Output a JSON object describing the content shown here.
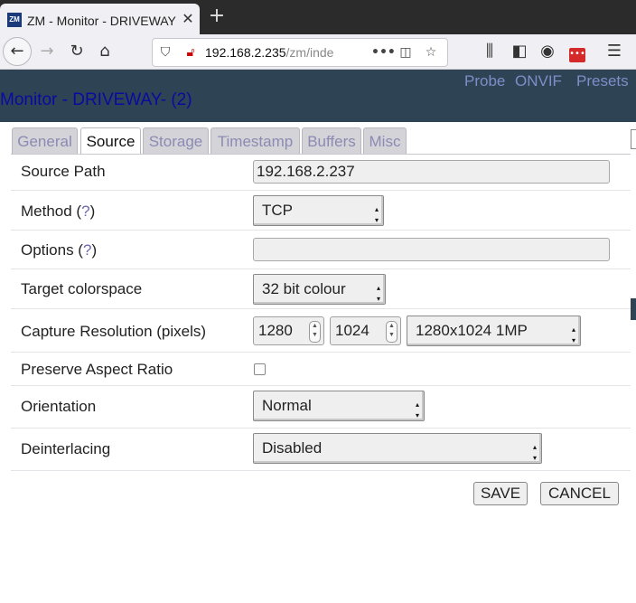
{
  "browser": {
    "tab_favicon": "ZM",
    "tab_title": "ZM - Monitor - DRIVEWAY",
    "tab_close_icon": "close-icon",
    "new_tab_icon": "plus-icon",
    "url_host": "192.168.2.235",
    "url_path": "/zm/inde",
    "page_actions": "•••"
  },
  "header": {
    "title": "Monitor - DRIVEWAY- (2)",
    "links": [
      "Probe",
      "ONVIF",
      "Presets"
    ]
  },
  "tabs": [
    "General",
    "Source",
    "Storage",
    "Timestamp",
    "Buffers",
    "Misc"
  ],
  "active_tab": "Source",
  "form": {
    "source_path": {
      "label": "Source Path",
      "value": "192.168.2.237"
    },
    "method": {
      "label": "Method (",
      "help": "?",
      "label_end": ")",
      "value": "TCP"
    },
    "options": {
      "label": "Options (",
      "help": "?",
      "label_end": ")",
      "value": ""
    },
    "colorspace": {
      "label": "Target colorspace",
      "value": "32 bit colour"
    },
    "capture_res": {
      "label": "Capture Resolution (pixels)",
      "width": "1280",
      "height": "1024",
      "preset": "1280x1024 1MP"
    },
    "aspect": {
      "label": "Preserve Aspect Ratio",
      "checked": false
    },
    "orientation": {
      "label": "Orientation",
      "value": "Normal"
    },
    "deinterlacing": {
      "label": "Deinterlacing",
      "value": "Disabled"
    }
  },
  "buttons": {
    "save": "SAVE",
    "cancel": "CANCEL"
  }
}
